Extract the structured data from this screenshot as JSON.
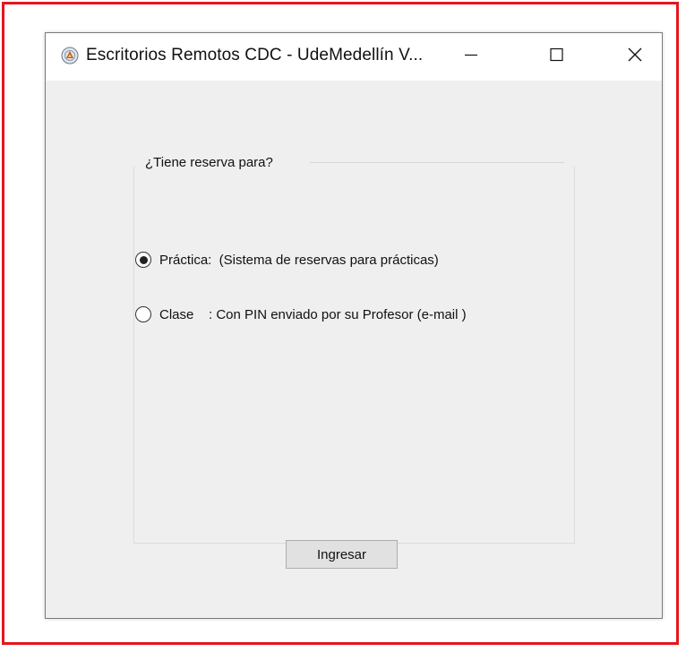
{
  "window": {
    "title": "Escritorios Remotos CDC - UdeMedellín V...",
    "icon": "app-emblem-icon",
    "controls": [
      "minimize-icon",
      "maximize-icon",
      "close-icon"
    ]
  },
  "reservation": {
    "group_title": "¿Tiene reserva para?",
    "options": [
      {
        "label": "Práctica:  (Sistema de reservas para prácticas)",
        "checked": true
      },
      {
        "label": "Clase    : Con PIN enviado por su Profesor (e-mail )",
        "checked": false
      }
    ]
  },
  "actions": {
    "submit_label": "Ingresar"
  },
  "colors": {
    "frame_border": "#e4161b",
    "window_bg": "#f0f0f0",
    "titlebar_bg": "#ffffff"
  }
}
